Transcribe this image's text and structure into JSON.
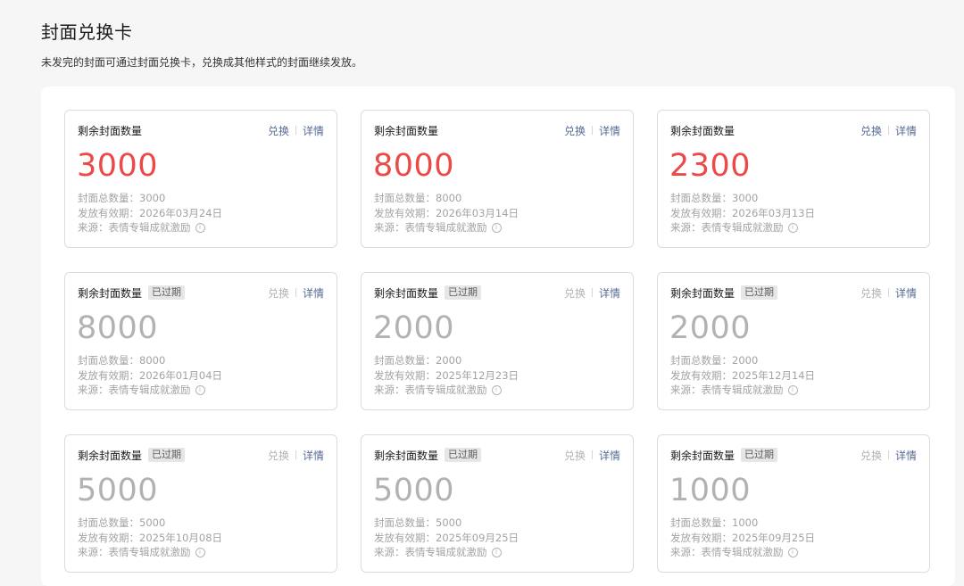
{
  "page": {
    "title": "封面兑换卡",
    "subtitle": "未发完的封面可通过封面兑换卡，兑换成其他样式的封面继续发放。"
  },
  "labels": {
    "remaining": "剩余封面数量",
    "expired_badge": "已过期",
    "redeem": "兑换",
    "details": "详情",
    "info_icon": "info-icon"
  },
  "colors": {
    "count_active": "#ea4a48",
    "count_expired": "#b2b2b2",
    "link": "#576b95"
  },
  "cards": [
    {
      "count": "3000",
      "expired": false,
      "total": "封面总数量：3000",
      "validity": "发放有效期：2026年03月24日",
      "source": "来源：表情专辑成就激励"
    },
    {
      "count": "8000",
      "expired": false,
      "total": "封面总数量：8000",
      "validity": "发放有效期：2026年03月14日",
      "source": "来源：表情专辑成就激励"
    },
    {
      "count": "2300",
      "expired": false,
      "total": "封面总数量：3000",
      "validity": "发放有效期：2026年03月13日",
      "source": "来源：表情专辑成就激励"
    },
    {
      "count": "8000",
      "expired": true,
      "total": "封面总数量：8000",
      "validity": "发放有效期：2026年01月04日",
      "source": "来源：表情专辑成就激励"
    },
    {
      "count": "2000",
      "expired": true,
      "total": "封面总数量：2000",
      "validity": "发放有效期：2025年12月23日",
      "source": "来源：表情专辑成就激励"
    },
    {
      "count": "2000",
      "expired": true,
      "total": "封面总数量：2000",
      "validity": "发放有效期：2025年12月14日",
      "source": "来源：表情专辑成就激励"
    },
    {
      "count": "5000",
      "expired": true,
      "total": "封面总数量：5000",
      "validity": "发放有效期：2025年10月08日",
      "source": "来源：表情专辑成就激励"
    },
    {
      "count": "5000",
      "expired": true,
      "total": "封面总数量：5000",
      "validity": "发放有效期：2025年09月25日",
      "source": "来源：表情专辑成就激励"
    },
    {
      "count": "1000",
      "expired": true,
      "total": "封面总数量：1000",
      "validity": "发放有效期：2025年09月25日",
      "source": "来源：表情专辑成就激励"
    }
  ]
}
